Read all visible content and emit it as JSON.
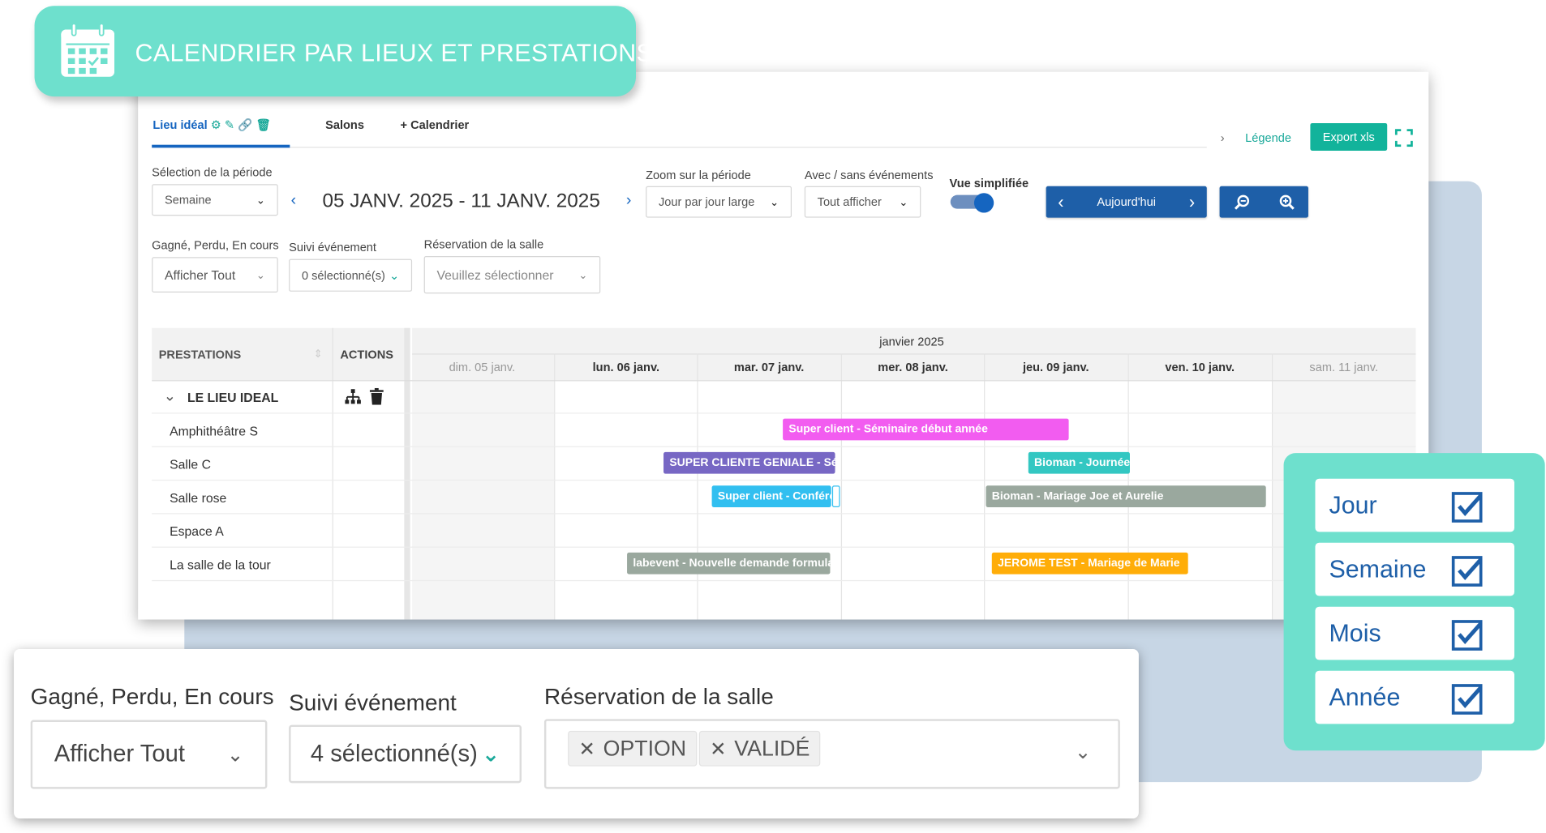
{
  "banner": {
    "title": "CALENDRIER PAR LIEUX ET PRESTATIONS",
    "icon": "calendar-icon"
  },
  "tabs": [
    {
      "label": "Lieu idéal",
      "active": true
    },
    {
      "label": "Salons",
      "active": false
    },
    {
      "label": "Calendrier",
      "active": false
    }
  ],
  "header_right": {
    "legend": "Légende",
    "export": "Export xls"
  },
  "filters": {
    "period_label": "Sélection de la période",
    "period_value": "Semaine",
    "period_range": "05 JANV. 2025 - 11 JANV. 2025",
    "zoom_label": "Zoom sur la période",
    "zoom_value": "Jour par jour large",
    "events_label": "Avec / sans événements",
    "events_value": "Tout afficher",
    "simplified_label": "Vue simplifiée",
    "today": "Aujourd'hui",
    "status_label": "Gagné, Perdu, En cours",
    "status_value": "Afficher Tout",
    "followup_label": "Suivi événement",
    "followup_value": "0 sélectionné(s)",
    "room_label": "Réservation de la salle",
    "room_placeholder": "Veuillez sélectionner"
  },
  "gantt": {
    "col_prestations": "PRESTATIONS",
    "col_actions": "ACTIONS",
    "month": "janvier 2025",
    "days": [
      "dim. 05 janv.",
      "lun. 06 janv.",
      "mar. 07 janv.",
      "mer. 08 janv.",
      "jeu. 09 janv.",
      "ven. 10 janv.",
      "sam. 11 janv."
    ],
    "group": "LE LIEU IDEAL",
    "rows": [
      "Amphithéâtre S",
      "Salle C",
      "Salle rose",
      "Espace A",
      "La salle de la tour"
    ],
    "events": [
      {
        "label": "Super client - Séminaire début année",
        "color": "#f25cf0"
      },
      {
        "label": "SUPER CLIENTE GENIALE - Séminaire",
        "color": "#7767c4"
      },
      {
        "label": "Bioman - Journée",
        "color": "#33c7c2"
      },
      {
        "label": "Super client - Conférence",
        "color": "#32bff0"
      },
      {
        "label": "Bioman - Mariage Joe et Aurelie",
        "color": "#9aa89e"
      },
      {
        "label": "labevent - Nouvelle demande formulaire",
        "color": "#9aa89e"
      },
      {
        "label": "JEROME TEST - Mariage de Marie",
        "color": "#ffad08"
      }
    ]
  },
  "zoom_panel": {
    "status_label": "Gagné, Perdu, En cours",
    "status_value": "Afficher Tout",
    "followup_label": "Suivi événement",
    "followup_value": "4 sélectionné(s)",
    "room_label": "Réservation de la salle",
    "chips": [
      "OPTION",
      "VALIDÉ"
    ]
  },
  "views": [
    "Jour",
    "Semaine",
    "Mois",
    "Année"
  ],
  "colors": {
    "brand_teal": "#6ee0cd",
    "primary_blue": "#1e5fa8",
    "export_green": "#12b39b"
  }
}
